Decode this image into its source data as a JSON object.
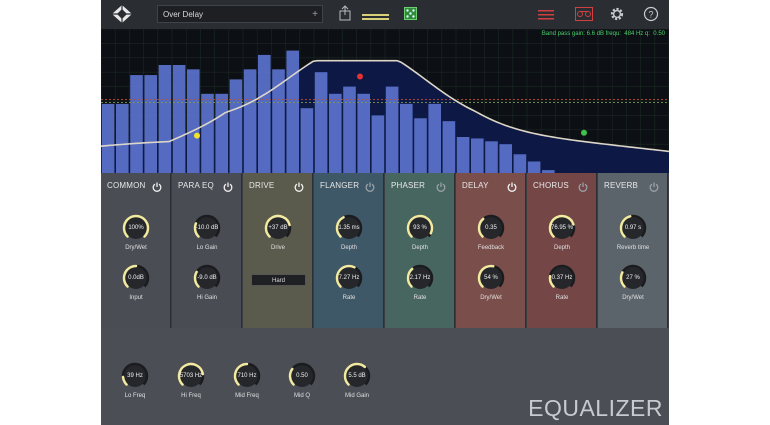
{
  "topbar": {
    "preset_name": "Over Delay",
    "preset_add": "+"
  },
  "spectrum": {
    "band_info": "Band pass gain: 6.6 dB frequ:  484 Hz q:  0.50",
    "bars": [
      0.48,
      0.48,
      0.68,
      0.68,
      0.75,
      0.75,
      0.72,
      0.55,
      0.55,
      0.65,
      0.72,
      0.82,
      0.72,
      0.85,
      0.45,
      0.7,
      0.55,
      0.6,
      0.55,
      0.4,
      0.6,
      0.48,
      0.38,
      0.48,
      0.36,
      0.25,
      0.24,
      0.22,
      0.2,
      0.13,
      0.08,
      0.02,
      0.0,
      0.0,
      0.0,
      0.0,
      0.0,
      0.0,
      0.0
    ],
    "handles": [
      {
        "name": "low-band-handle",
        "color": "#f2e22a"
      },
      {
        "name": "mid-band-handle",
        "color": "#e23232"
      },
      {
        "name": "high-band-handle",
        "color": "#3ec24a"
      }
    ]
  },
  "colors": {
    "knob_arc": "#f2eaa0",
    "bar_fill": "#5870c8",
    "curve": "#ddd6c8"
  },
  "modules": [
    {
      "title": "COMMON",
      "bg": "#4a4d54",
      "power_on": true,
      "knobs": [
        {
          "value": "100%",
          "label": "Dry/Wet",
          "level": 1.0
        },
        {
          "value": "0.0dB",
          "label": "Input",
          "level": 0.5
        }
      ]
    },
    {
      "title": "PARA EQ",
      "bg": "#494c53",
      "power_on": true,
      "knobs": [
        {
          "value": "-10.0 dB",
          "label": "Lo Gain",
          "level": 0.25
        },
        {
          "value": "-9.0 dB",
          "label": "Hi Gain",
          "level": 0.28
        }
      ]
    },
    {
      "title": "DRIVE",
      "bg": "#5a5b4c",
      "power_on": true,
      "knobs": [
        {
          "value": "+37 dB",
          "label": "Drive",
          "level": 0.78
        }
      ],
      "button": "Hard"
    },
    {
      "title": "FLANGER",
      "bg": "#3f5868",
      "power_on": false,
      "knobs": [
        {
          "value": "1.35  ms",
          "label": "Depth",
          "level": 0.4
        },
        {
          "value": "7.27  Hz",
          "label": "Rate",
          "level": 0.6
        }
      ]
    },
    {
      "title": "PHASER",
      "bg": "#486660",
      "power_on": false,
      "knobs": [
        {
          "value": "93 %",
          "label": "Depth",
          "level": 0.93
        },
        {
          "value": "2.17 Hz",
          "label": "Rate",
          "level": 0.35
        }
      ]
    },
    {
      "title": "DELAY",
      "bg": "#7a4e4a",
      "power_on": true,
      "knobs": [
        {
          "value": "0.35",
          "label": "Feedback",
          "level": 0.35
        },
        {
          "value": "54  %",
          "label": "Dry/Wet",
          "level": 0.54
        }
      ]
    },
    {
      "title": "CHORUS",
      "bg": "#744646",
      "power_on": false,
      "knobs": [
        {
          "value": "76.95 %",
          "label": "Depth",
          "level": 0.77
        },
        {
          "value": "0.37  Hz",
          "label": "Rate",
          "level": 0.2
        }
      ]
    },
    {
      "title": "REVERB",
      "bg": "#5b646a",
      "power_on": false,
      "knobs": [
        {
          "value": "0.97 s",
          "label": "Reverb time",
          "level": 0.45
        },
        {
          "value": "27 %",
          "label": "Dry/Wet",
          "level": 0.27
        }
      ]
    }
  ],
  "equalizer": {
    "title": "EQUALIZER",
    "knobs": [
      {
        "value": "39 Hz",
        "label": "Lo Freq",
        "level": 0.15
      },
      {
        "value": "5703 Hz",
        "label": "Hi Freq",
        "level": 0.8
      },
      {
        "value": "710 Hz",
        "label": "Mid Freq",
        "level": 0.5
      },
      {
        "value": "0.50",
        "label": "Mid Q",
        "level": 0.3
      },
      {
        "value": "5.5 dB",
        "label": "Mid Gain",
        "level": 0.65
      }
    ]
  }
}
